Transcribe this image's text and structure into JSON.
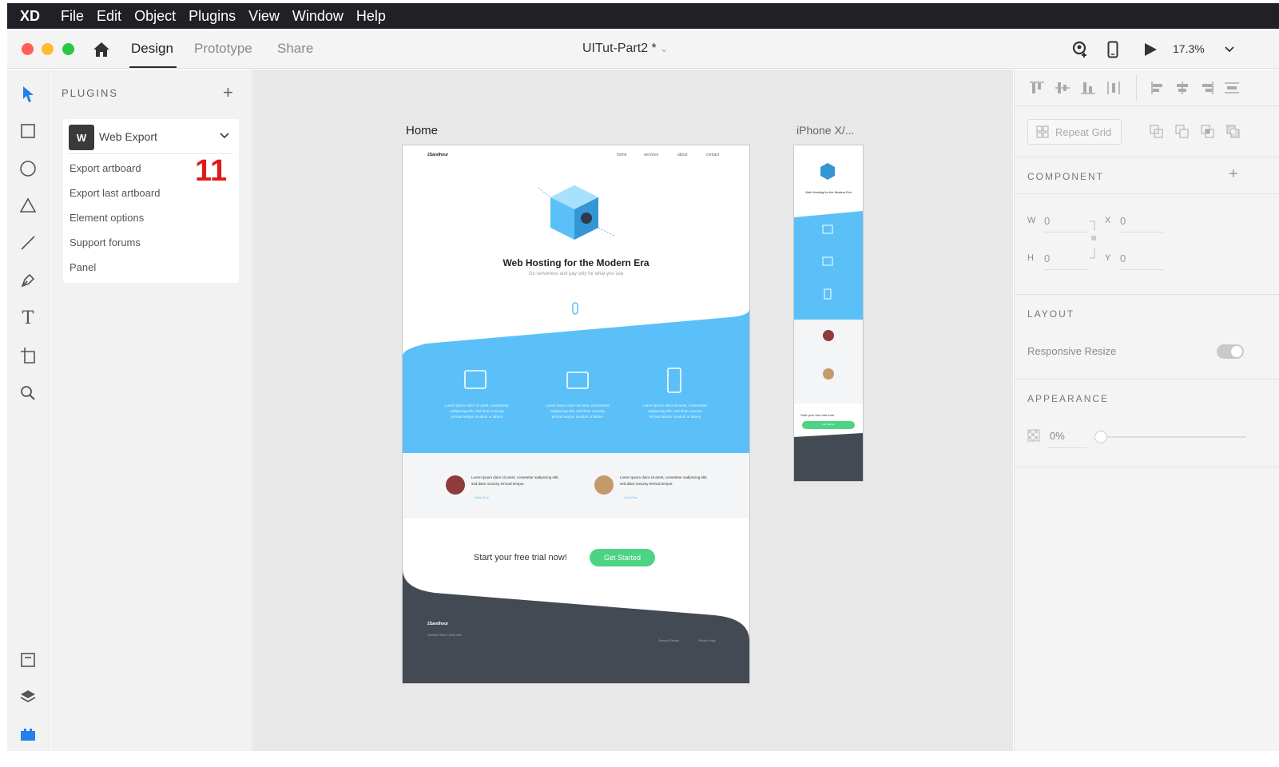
{
  "menubar": {
    "app": "XD",
    "items": [
      "File",
      "Edit",
      "Object",
      "Plugins",
      "View",
      "Window",
      "Help"
    ]
  },
  "toolbar": {
    "tabs": [
      "Design",
      "Prototype",
      "Share"
    ],
    "active_tab": "Design",
    "document_title": "UITut-Part2 *",
    "zoom": "17.3%"
  },
  "plugins_panel": {
    "header": "PLUGINS",
    "plugin_badge": "W",
    "plugin_name": "Web Export",
    "items": [
      "Export artboard",
      "Export last artboard",
      "Element options",
      "Support forums",
      "Panel"
    ],
    "annotation": "11"
  },
  "canvas": {
    "artboard_main_label": "Home",
    "artboard_mobile_label": "iPhone X/...",
    "hero_title": "Web Hosting for the Modern Era",
    "hero_subtitle": "Go serverless and pay only for what you use",
    "cta_text": "Start your free trial now!",
    "cta_button": "Get Started",
    "nav": [
      "home",
      "services",
      "about",
      "contact"
    ],
    "brand": "2Sandhour",
    "features": [
      "Lorem ipsum dolor sit amet, consectetur sadipscing elitr, sed diam nonumy eirmod tempor invidunt ut labore",
      "Lorem ipsum dolor sit amet, consectetur sadipscing elitr, sed diam nonumy eirmod tempor invidunt ut labore",
      "Lorem ipsum dolor sit amet, consectetur sadipscing elitr, sed diam nonumy eirmod tempor invidunt ut labore"
    ],
    "testimonials": [
      {
        "quote": "Lorem ipsum dolor sit amet, consetetur sadipscing elitr, sed diam nonumy eirmod tempor.",
        "link": "- Katie Doe"
      },
      {
        "quote": "Lorem ipsum dolor sit amet, consetetur sadipscing elitr, sed diam nonumy eirmod tempor.",
        "link": "- John Doe"
      }
    ],
    "footer_left": "Hamster Place, 12345 USA",
    "footer_links": [
      "Terms of Service",
      "Privacy Policy"
    ],
    "mobile_title": "Web Hosting for the Modern Era",
    "mobile_cta": "Start your free trial now!",
    "mobile_button": "Get Started"
  },
  "right_panel": {
    "repeat_grid": "Repeat Grid",
    "component_header": "COMPONENT",
    "w_label": "W",
    "w_value": "0",
    "x_label": "X",
    "x_value": "0",
    "h_label": "H",
    "h_value": "0",
    "y_label": "Y",
    "y_value": "0",
    "layout_header": "LAYOUT",
    "responsive_resize": "Responsive Resize",
    "appearance_header": "APPEARANCE",
    "opacity": "0%"
  },
  "colors": {
    "menubar_bg": "#1f2127",
    "accent_blue": "#5bc0f8",
    "green_button": "#4cd383",
    "footer_dark": "#434a54",
    "annotation_red": "#e01a1a"
  }
}
